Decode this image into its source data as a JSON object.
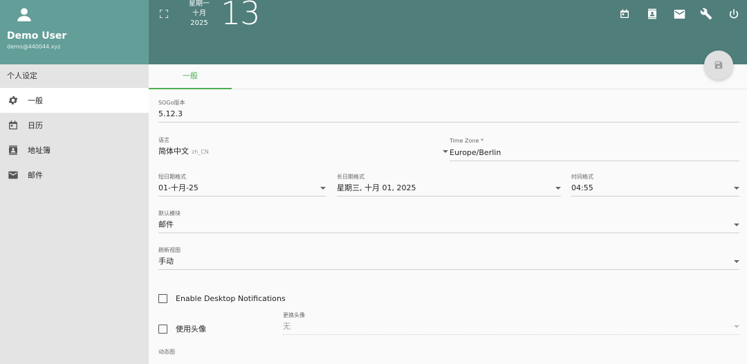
{
  "user": {
    "name": "Demo User",
    "email": "demo@440044.xyz"
  },
  "sidebar": {
    "section_title": "个人设定",
    "items": [
      {
        "label": "一般",
        "icon": "gear-icon",
        "active": true
      },
      {
        "label": "日历",
        "icon": "calendar-icon",
        "active": false
      },
      {
        "label": "地址簿",
        "icon": "contacts-icon",
        "active": false
      },
      {
        "label": "邮件",
        "icon": "mail-icon",
        "active": false
      }
    ]
  },
  "topbar": {
    "weekday": "星期一",
    "month": "十月",
    "year": "2025",
    "day": "13",
    "icons": [
      "calendar-icon",
      "contacts-icon",
      "mail-icon",
      "wrench-icon",
      "power-icon"
    ]
  },
  "tabs": [
    {
      "label": "一般"
    }
  ],
  "form": {
    "sogo_version": {
      "label": "SOGo版本",
      "value": "5.12.3"
    },
    "language": {
      "label": "语言",
      "value": "简体中文",
      "sub": "zh_CN"
    },
    "timezone": {
      "label": "Time Zone *",
      "value": "Europe/Berlin"
    },
    "short_date": {
      "label": "短日期格式",
      "value": "01-十月-25"
    },
    "long_date": {
      "label": "长日期格式",
      "value": "星期三, 十月 01, 2025"
    },
    "time_format": {
      "label": "时间格式",
      "value": "04:55"
    },
    "default_module": {
      "label": "默认模块",
      "value": "邮件"
    },
    "refresh_view": {
      "label": "刷新视图",
      "value": "手动"
    },
    "desktop_notifications": {
      "label": "Enable Desktop Notifications",
      "checked": false
    },
    "use_avatar": {
      "label": "使用头像",
      "checked": false
    },
    "alternate_avatar": {
      "label": "更换头像",
      "value": "无"
    },
    "animation": {
      "label": "动态图"
    }
  },
  "colors": {
    "sidebar_header": "#639e98",
    "topbar": "#4f7e7b",
    "accent": "#4caf50"
  }
}
